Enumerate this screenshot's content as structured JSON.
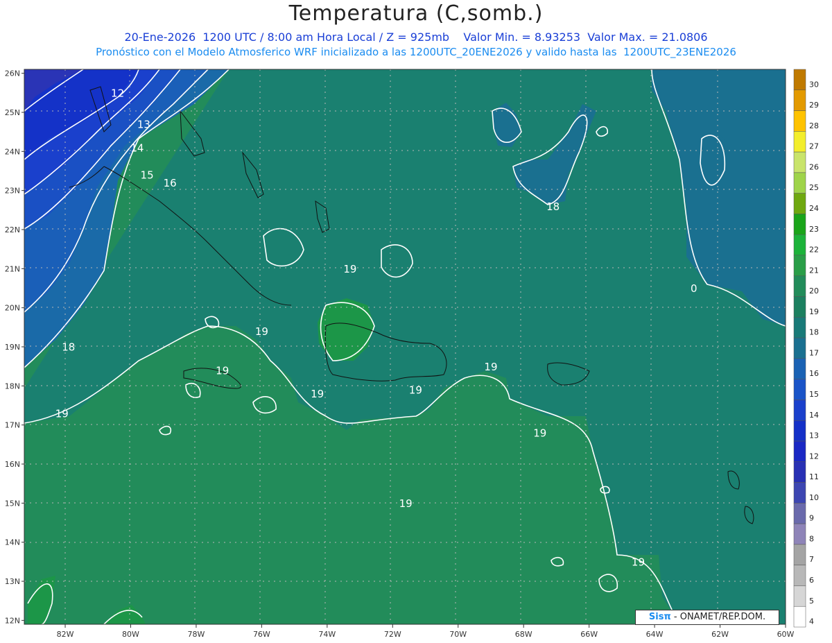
{
  "header": {
    "title": "Temperatura (C,somb.)",
    "subtitle1": "20-Ene-2026  1200 UTC / 8:00 am Hora Local / Z = 925mb    Valor Min. = 8.93253  Valor Max. = 21.0806",
    "subtitle2": "Pronóstico con el Modelo Atmosferico WRF inicializado a las 1200UTC_20ENE2026 y valido hasta las  1200UTC_23ENE2026"
  },
  "map": {
    "lon_labels": [
      "82W",
      "80W",
      "78W",
      "76W",
      "74W",
      "72W",
      "70W",
      "68W",
      "66W",
      "64W",
      "62W",
      "60W"
    ],
    "lat_labels": [
      "26N",
      "25N",
      "24N",
      "23N",
      "22N",
      "21N",
      "20N",
      "19N",
      "18N",
      "17N",
      "16N",
      "15N",
      "14N",
      "13N",
      "12N"
    ],
    "contour_labels": [
      {
        "text": "12",
        "lon": -80.4,
        "lat": 25.4
      },
      {
        "text": "13",
        "lon": -79.6,
        "lat": 24.6
      },
      {
        "text": "14",
        "lon": -79.8,
        "lat": 24.0
      },
      {
        "text": "15",
        "lon": -79.5,
        "lat": 23.3
      },
      {
        "text": "16",
        "lon": -78.8,
        "lat": 23.1
      },
      {
        "text": "18",
        "lon": -81.9,
        "lat": 18.9
      },
      {
        "text": "19",
        "lon": -82.1,
        "lat": 17.2
      },
      {
        "text": "19",
        "lon": -76.0,
        "lat": 19.3
      },
      {
        "text": "19",
        "lon": -77.2,
        "lat": 18.3
      },
      {
        "text": "19",
        "lon": -74.3,
        "lat": 17.7
      },
      {
        "text": "19",
        "lon": -73.3,
        "lat": 20.9
      },
      {
        "text": "19",
        "lon": -71.3,
        "lat": 17.8
      },
      {
        "text": "19",
        "lon": -69.0,
        "lat": 18.4
      },
      {
        "text": "19",
        "lon": -67.5,
        "lat": 16.7
      },
      {
        "text": "19",
        "lon": -71.6,
        "lat": 14.9
      },
      {
        "text": "19",
        "lon": -64.5,
        "lat": 13.4
      },
      {
        "text": "18",
        "lon": -67.1,
        "lat": 22.5
      },
      {
        "text": "0",
        "lon": -62.8,
        "lat": 20.4
      }
    ]
  },
  "colorbar": {
    "labels": [
      "30",
      "29",
      "28",
      "27",
      "26",
      "25",
      "24",
      "23",
      "22",
      "21",
      "20",
      "19",
      "18",
      "17",
      "16",
      "15",
      "14",
      "13",
      "12",
      "11",
      "10",
      "9",
      "8",
      "7",
      "6",
      "5",
      "4"
    ],
    "colors": [
      "#c07a00",
      "#e39a00",
      "#ffc300",
      "#f3ee2c",
      "#c9e46b",
      "#9fd44a",
      "#6fa810",
      "#1aa51a",
      "#1cb33a",
      "#2a9e48",
      "#228c5a",
      "#1c8060",
      "#197a78",
      "#1a7090",
      "#1a62b4",
      "#1a54c8",
      "#1a40cc",
      "#1430c8",
      "#1a28c4",
      "#2830b4",
      "#3d46b2",
      "#6a6aac",
      "#8e84b8",
      "#a4a4a4",
      "#b8b8b8",
      "#d6d6d6",
      "#ffffff"
    ]
  },
  "credit": {
    "logo": "Sisπ",
    "text": " - ONAMET/REP.DOM."
  }
}
